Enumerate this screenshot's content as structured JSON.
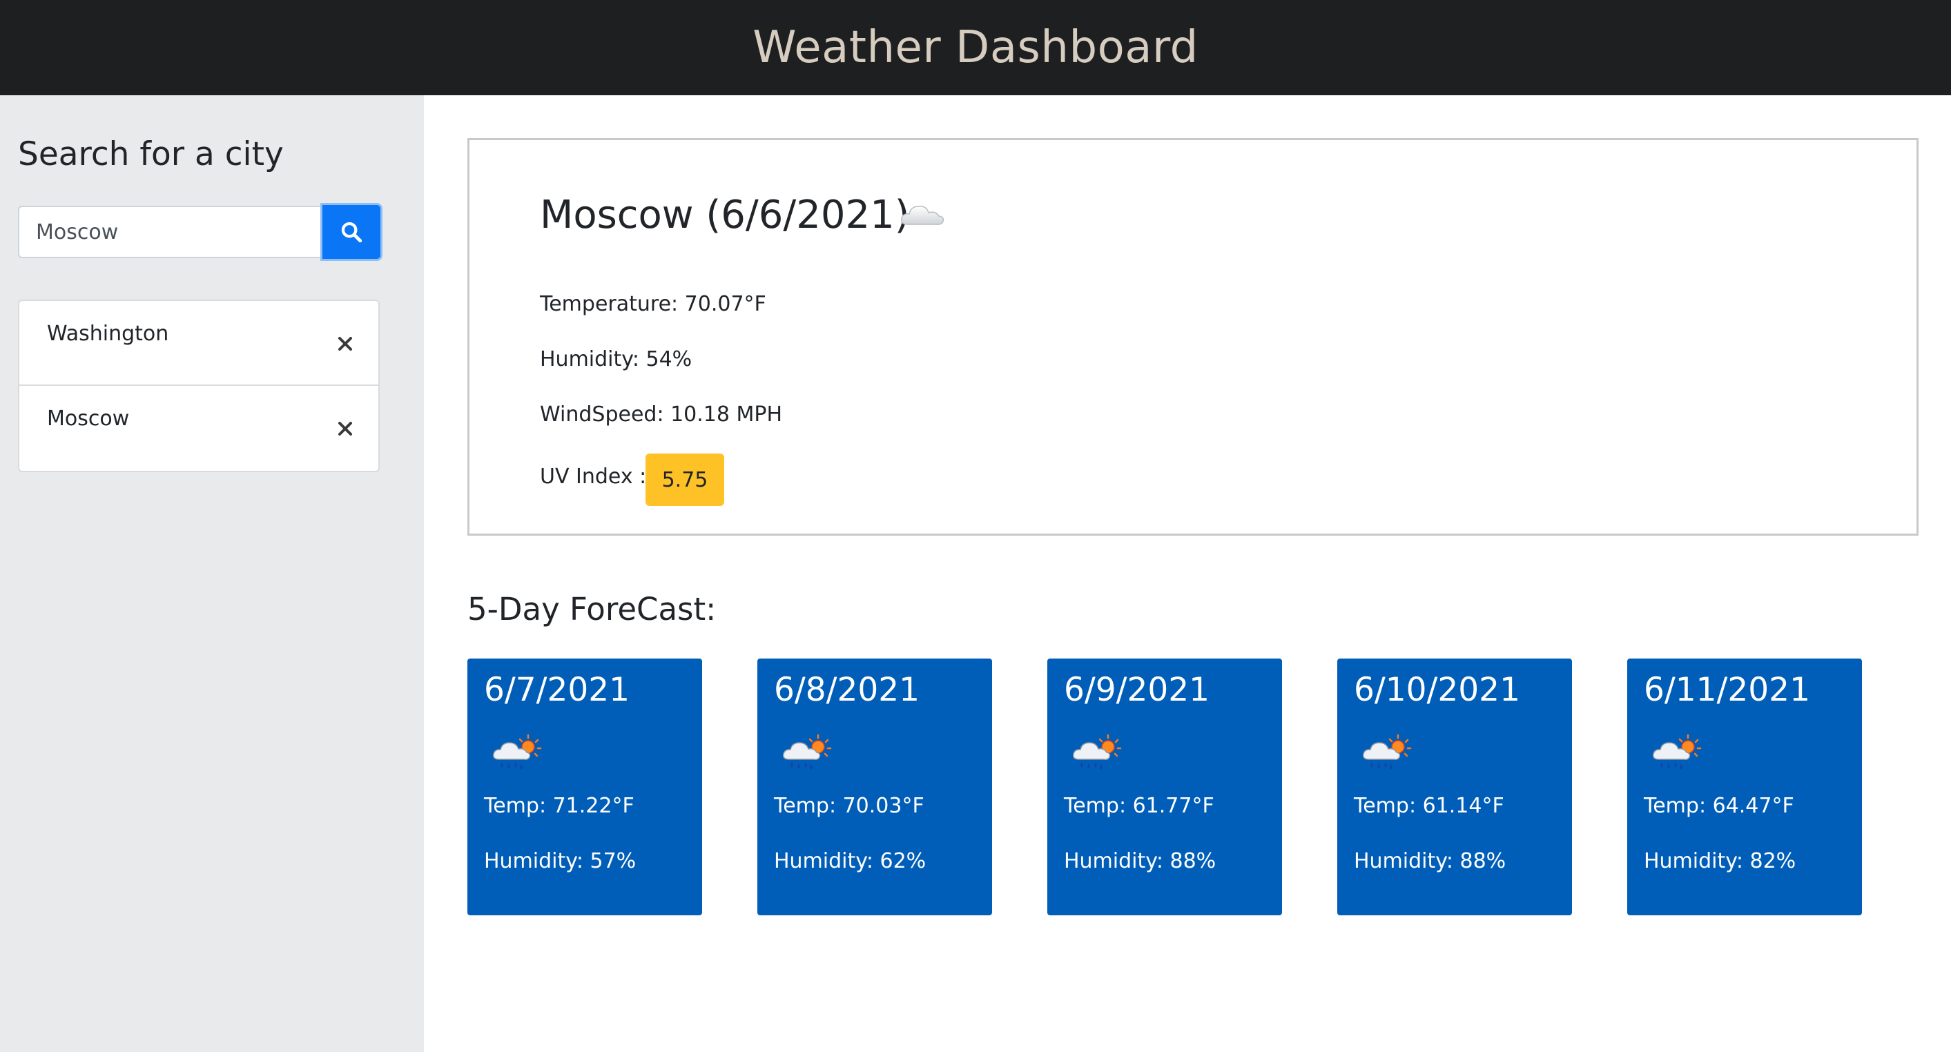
{
  "header": {
    "title": "Weather Dashboard"
  },
  "sidebar": {
    "heading": "Search for a city",
    "search": {
      "value": "Moscow",
      "placeholder": ""
    },
    "search_button_icon": "search-icon",
    "history": [
      {
        "label": "Washington",
        "remove_icon": "close-icon"
      },
      {
        "label": "Moscow",
        "remove_icon": "close-icon"
      }
    ]
  },
  "current": {
    "title": "Moscow (6/6/2021)",
    "icon": "cloud-icon",
    "temperature": "Temperature: 70.07°F",
    "humidity": "Humidity: 54%",
    "windspeed": "WindSpeed: 10.18 MPH",
    "uv_label": "UV Index :",
    "uv_value": "5.75",
    "uv_color": "#ffc226"
  },
  "forecast": {
    "title": "5-Day ForeCast:",
    "card_color": "#005eb8",
    "days": [
      {
        "date": "6/7/2021",
        "icon": "rain-sun-icon",
        "temp": "Temp: 71.22°F",
        "humidity": "Humidity: 57%"
      },
      {
        "date": "6/8/2021",
        "icon": "rain-sun-icon",
        "temp": "Temp: 70.03°F",
        "humidity": "Humidity: 62%"
      },
      {
        "date": "6/9/2021",
        "icon": "rain-sun-icon",
        "temp": "Temp: 61.77°F",
        "humidity": "Humidity: 88%"
      },
      {
        "date": "6/10/2021",
        "icon": "rain-sun-icon",
        "temp": "Temp: 61.14°F",
        "humidity": "Humidity: 88%"
      },
      {
        "date": "6/11/2021",
        "icon": "rain-sun-icon",
        "temp": "Temp: 64.47°F",
        "humidity": "Humidity: 82%"
      }
    ]
  }
}
